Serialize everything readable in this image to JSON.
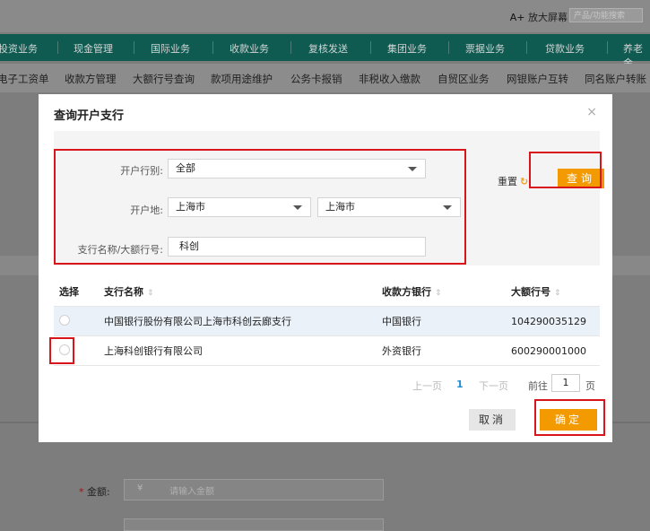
{
  "top": {
    "zoom_prefix": "A+",
    "zoom_label": "放大屏幕",
    "search_placeholder": "产品/功能搜索"
  },
  "nav": [
    "投资业务",
    "现金管理",
    "国际业务",
    "收款业务",
    "复核发送",
    "集团业务",
    "票据业务",
    "贷款业务",
    "养老金"
  ],
  "subnav": [
    "电子工资单",
    "收款方管理",
    "大额行号查询",
    "款项用途维护",
    "公务卡报销",
    "非税收入缴款",
    "自贸区业务",
    "网银账户互转",
    "同名账户转账"
  ],
  "dialog": {
    "title": "查询开户支行",
    "close": "×",
    "filter": {
      "bank_label": "开户行别:",
      "bank_value": "全部",
      "location_label": "开户地:",
      "province_value": "上海市",
      "city_value": "上海市",
      "branch_label": "支行名称/大额行号:",
      "branch_value": "科创"
    },
    "reset_label": "重置",
    "reset_icon": "refresh-icon",
    "query_label": "查询",
    "table": {
      "headers": {
        "select": "选择",
        "name": "支行名称",
        "bank": "收款方银行",
        "code": "大额行号"
      },
      "rows": [
        {
          "name": "中国银行股份有限公司上海市科创云廊支行",
          "bank": "中国银行",
          "code": "104290035129"
        },
        {
          "name": "上海科创银行有限公司",
          "bank": "外资银行",
          "code": "600290001000"
        }
      ]
    },
    "pager": {
      "prev": "上一页",
      "page": "1",
      "next": "下一页",
      "goto": "前往",
      "goto_value": "1",
      "unit": "页"
    },
    "cancel_label": "取消",
    "confirm_label": "确定"
  },
  "form": {
    "required_mark": "*",
    "amount_label": "金额:",
    "currency": "¥",
    "amount_placeholder": "请输入金额"
  },
  "colors": {
    "accent": "#f39a00",
    "nav_bg": "#0f5a51",
    "highlight": "#d8151b",
    "link": "#1e8fd6"
  }
}
